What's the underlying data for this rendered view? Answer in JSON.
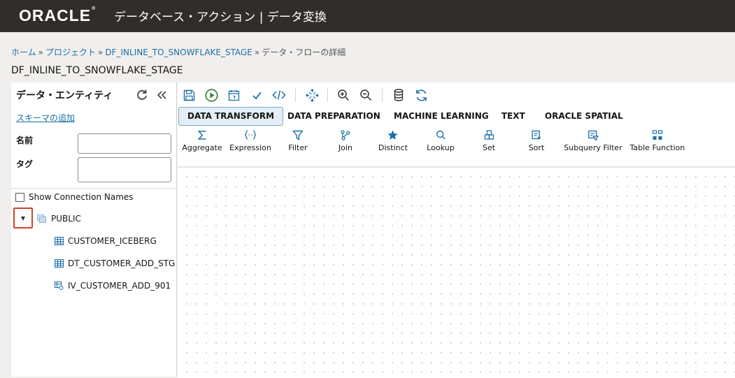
{
  "header": {
    "logo": "ORACLE",
    "title": "データベース・アクション | データ変換"
  },
  "breadcrumb": {
    "home": "ホーム",
    "projects": "プロジェクト",
    "flow": "DF_INLINE_TO_SNOWFLAKE_STAGE",
    "current": "データ・フローの詳細",
    "separator": "»"
  },
  "page_title": "DF_INLINE_TO_SNOWFLAKE_STAGE",
  "left_panel": {
    "title": "データ・エンティティ",
    "add_schema_link": "スキーマの追加",
    "name_label": "名前",
    "tag_label": "タグ",
    "name_value": "",
    "tag_value": "",
    "show_connection_names": "Show Connection Names",
    "tree": {
      "schema": "PUBLIC",
      "items": [
        "CUSTOMER_ICEBERG",
        "DT_CUSTOMER_ADD_STG",
        "IV_CUSTOMER_ADD_901"
      ]
    }
  },
  "tabs": [
    "DATA TRANSFORM",
    "DATA PREPARATION",
    "MACHINE LEARNING",
    "TEXT",
    "ORACLE SPATIAL"
  ],
  "tools": [
    "Aggregate",
    "Expression",
    "Filter",
    "Join",
    "Distinct",
    "Lookup",
    "Set",
    "Sort",
    "Subquery Filter",
    "Table Function"
  ],
  "colors": {
    "header_bg": "#312d2a",
    "link": "#1a6fa8",
    "icon_blue": "#1a6fa8",
    "run_green": "#2e7d32",
    "highlight_red": "#d1432d"
  }
}
